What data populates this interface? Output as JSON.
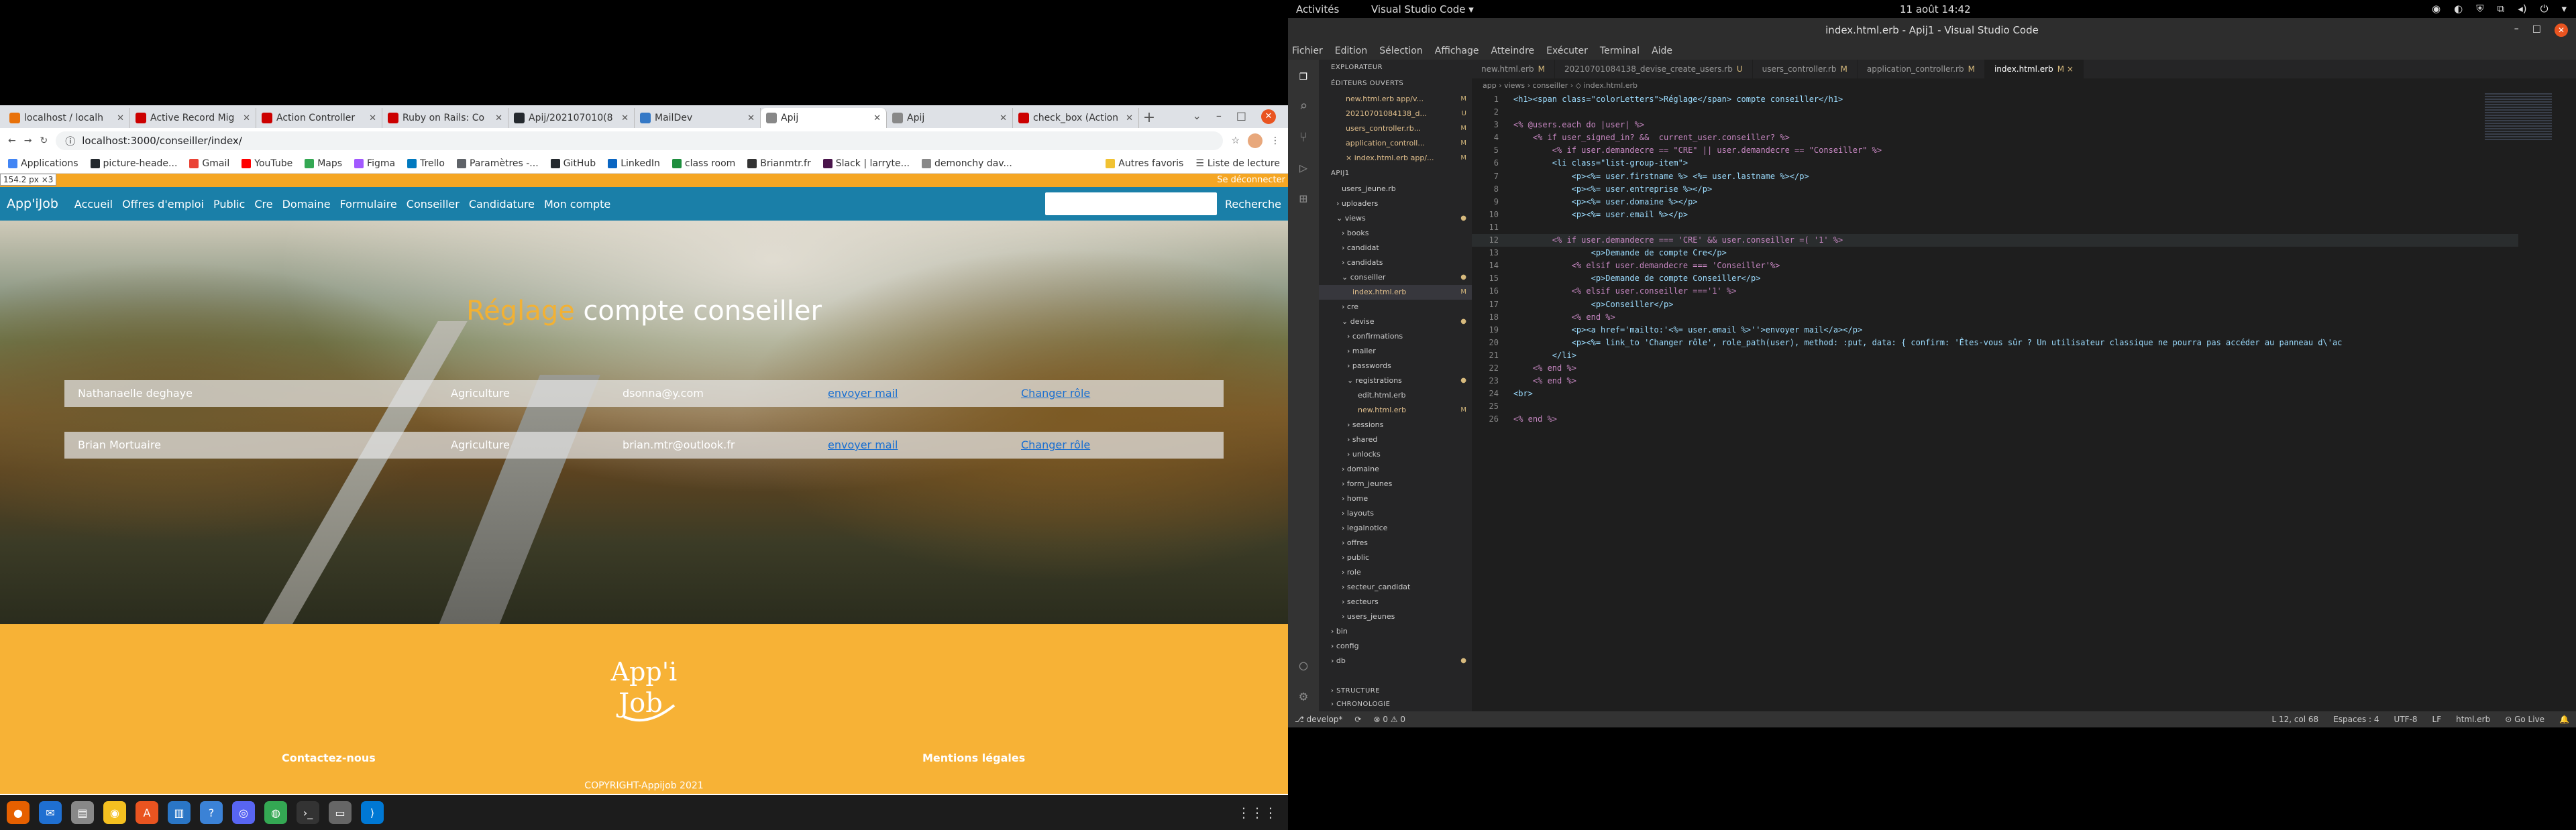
{
  "topbar": {
    "activities": "Activités",
    "app": "Visual Studio Code ▾",
    "clock": "11 août  14:42"
  },
  "browser": {
    "tabs": [
      {
        "title": "localhost / localh",
        "color": "#e8710a"
      },
      {
        "title": "Active Record Mig",
        "color": "#cc0000"
      },
      {
        "title": "Action Controller",
        "color": "#cc0000"
      },
      {
        "title": "Ruby on Rails: Co",
        "color": "#cc0000"
      },
      {
        "title": "Apij/202107010(8",
        "color": "#24292e"
      },
      {
        "title": "MailDev",
        "color": "#3478c6"
      },
      {
        "title": "Apij",
        "color": "#888888"
      },
      {
        "title": "Apij",
        "color": "#888888"
      },
      {
        "title": "check_box (Action",
        "color": "#cc0000"
      }
    ],
    "new_tab": "+",
    "url": "localhost:3000/conseiller/index/",
    "bookmarks": [
      {
        "label": "Applications",
        "color": "#4285f4"
      },
      {
        "label": "picture-heade...",
        "color": "#24292e"
      },
      {
        "label": "Gmail",
        "color": "#ea4335"
      },
      {
        "label": "YouTube",
        "color": "#ff0000"
      },
      {
        "label": "Maps",
        "color": "#34a853"
      },
      {
        "label": "Figma",
        "color": "#a259ff"
      },
      {
        "label": "Trello",
        "color": "#0079bf"
      },
      {
        "label": "Paramètres -...",
        "color": "#5f6368"
      },
      {
        "label": "GitHub",
        "color": "#24292e"
      },
      {
        "label": "LinkedIn",
        "color": "#0a66c2"
      },
      {
        "label": "class room",
        "color": "#1e8e3e"
      },
      {
        "label": "Brianmtr.fr",
        "color": "#333333"
      },
      {
        "label": "Slack | larryte...",
        "color": "#4a154b"
      },
      {
        "label": "demonchy dav...",
        "color": "#888888"
      }
    ],
    "other_bookmarks": "Autres favoris",
    "reading_list": "Liste de lecture",
    "viewport_size": "154.2 px ×3",
    "logout": "Se déconnecter"
  },
  "app": {
    "brand": "App'iJob",
    "nav": [
      "Accueil",
      "Offres d'emploi",
      "Public",
      "Cre",
      "Domaine",
      "Formulaire",
      "Conseiller",
      "Candidature",
      "Mon compte"
    ],
    "search_button": "Recherche",
    "title_highlight": "Réglage",
    "title_rest": " compte conseiller",
    "users": [
      {
        "name": "Nathanaelle deghaye",
        "domain": "Agriculture",
        "email": "dsonna@y.com",
        "mail_link": "envoyer mail",
        "role_link": "Changer rôle"
      },
      {
        "name": "Brian Mortuaire",
        "domain": "Agriculture",
        "email": "brian.mtr@outlook.fr",
        "mail_link": "envoyer mail",
        "role_link": "Changer rôle"
      }
    ],
    "footer": {
      "logo_top": "App'i",
      "logo_bottom": "Job",
      "contact": "Contactez-nous",
      "legal": "Mentions légales",
      "copyright": "COPYRIGHT-Appijob 2021"
    }
  },
  "dock": {
    "apps": [
      {
        "name": "firefox-icon",
        "color": "#e66000",
        "glyph": "●"
      },
      {
        "name": "thunderbird-icon",
        "color": "#1f6fd1",
        "glyph": "✉"
      },
      {
        "name": "files-icon",
        "color": "#888888",
        "glyph": "▤"
      },
      {
        "name": "rhythmbox-icon",
        "color": "#f4c020",
        "glyph": "◉"
      },
      {
        "name": "software-icon",
        "color": "#e95420",
        "glyph": "A"
      },
      {
        "name": "writer-icon",
        "color": "#2a76c6",
        "glyph": "▥"
      },
      {
        "name": "help-icon",
        "color": "#3b82d6",
        "glyph": "?"
      },
      {
        "name": "discord-icon",
        "color": "#5865f2",
        "glyph": "◎"
      },
      {
        "name": "chrome-icon",
        "color": "#34a853",
        "glyph": "◍"
      },
      {
        "name": "terminal-icon",
        "color": "#333333",
        "glyph": "›_"
      },
      {
        "name": "files2-icon",
        "color": "#666666",
        "glyph": "▭"
      },
      {
        "name": "vscode-icon",
        "color": "#0078d4",
        "glyph": "⟩"
      }
    ],
    "grid": "⋮⋮⋮"
  },
  "vscode": {
    "title": "index.html.erb - Apij1 - Visual Studio Code",
    "menu": [
      "Fichier",
      "Edition",
      "Sélection",
      "Affichage",
      "Atteindre",
      "Exécuter",
      "Terminal",
      "Aide"
    ],
    "open_editors_label": "ÉDITEURS OUVERTS",
    "open_editors": [
      {
        "name": "new.html.erb  app/v...",
        "mark": "M"
      },
      {
        "name": "20210701084138_d...",
        "mark": "U"
      },
      {
        "name": "users_controller.rb...",
        "mark": "M"
      },
      {
        "name": "application_controll...",
        "mark": "M"
      },
      {
        "name": "× index.html.erb  app/...",
        "mark": "M"
      }
    ],
    "project_label": "APIJ1",
    "explorer_header": "EXPLORATEUR",
    "tree": [
      {
        "label": "users_jeune.rb",
        "indent": 24,
        "mark": ""
      },
      {
        "label": "› uploaders",
        "indent": 16,
        "mark": ""
      },
      {
        "label": "⌄ views",
        "indent": 16,
        "mark": "●"
      },
      {
        "label": "› books",
        "indent": 24,
        "mark": ""
      },
      {
        "label": "› candidat",
        "indent": 24,
        "mark": ""
      },
      {
        "label": "› candidats",
        "indent": 24,
        "mark": ""
      },
      {
        "label": "⌄ conseiller",
        "indent": 24,
        "mark": "●"
      },
      {
        "label": "index.html.erb",
        "indent": 40,
        "mark": "M"
      },
      {
        "label": "› cre",
        "indent": 24,
        "mark": ""
      },
      {
        "label": "⌄ devise",
        "indent": 24,
        "mark": "●"
      },
      {
        "label": "› confirmations",
        "indent": 32,
        "mark": ""
      },
      {
        "label": "› mailer",
        "indent": 32,
        "mark": ""
      },
      {
        "label": "› passwords",
        "indent": 32,
        "mark": ""
      },
      {
        "label": "⌄ registrations",
        "indent": 32,
        "mark": "●"
      },
      {
        "label": "edit.html.erb",
        "indent": 48,
        "mark": ""
      },
      {
        "label": "new.html.erb",
        "indent": 48,
        "mark": "M"
      },
      {
        "label": "› sessions",
        "indent": 32,
        "mark": ""
      },
      {
        "label": "› shared",
        "indent": 32,
        "mark": ""
      },
      {
        "label": "› unlocks",
        "indent": 32,
        "mark": ""
      },
      {
        "label": "› domaine",
        "indent": 24,
        "mark": ""
      },
      {
        "label": "› form_jeunes",
        "indent": 24,
        "mark": ""
      },
      {
        "label": "› home",
        "indent": 24,
        "mark": ""
      },
      {
        "label": "› layouts",
        "indent": 24,
        "mark": ""
      },
      {
        "label": "› legalnotice",
        "indent": 24,
        "mark": ""
      },
      {
        "label": "› offres",
        "indent": 24,
        "mark": ""
      },
      {
        "label": "› public",
        "indent": 24,
        "mark": ""
      },
      {
        "label": "› role",
        "indent": 24,
        "mark": ""
      },
      {
        "label": "› secteur_candidat",
        "indent": 24,
        "mark": ""
      },
      {
        "label": "› secteurs",
        "indent": 24,
        "mark": ""
      },
      {
        "label": "› users_jeunes",
        "indent": 24,
        "mark": ""
      },
      {
        "label": "› bin",
        "indent": 8,
        "mark": ""
      },
      {
        "label": "› config",
        "indent": 8,
        "mark": ""
      },
      {
        "label": "› db",
        "indent": 8,
        "mark": "●"
      }
    ],
    "outline": "› STRUCTURE",
    "timeline": "› CHRONOLOGIE",
    "tabs": [
      {
        "label": "new.html.erb",
        "mark": "M",
        "active": false
      },
      {
        "label": "20210701084138_devise_create_users.rb",
        "mark": "U",
        "active": false
      },
      {
        "label": "users_controller.rb",
        "mark": "M",
        "active": false
      },
      {
        "label": "application_controller.rb",
        "mark": "M",
        "active": false
      },
      {
        "label": "index.html.erb",
        "mark": "M ×",
        "active": true
      }
    ],
    "breadcrumb": "app › views › conseiller › ◇ index.html.erb",
    "code": [
      "<h1><span class=\"colorLetters\">Réglage</span> compte conseiller</h1>",
      "",
      "<% @users.each do |user| %>",
      "    <% if user_signed_in? &&  current_user.conseiller? %>",
      "        <% if user.demandecre == \"CRE\" || user.demandecre == \"Conseiller\" %>",
      "        <li class=\"list-group-item\">",
      "            <p><%= user.firstname %> <%= user.lastname %></p>",
      "            <p><%= user.entreprise %></p>",
      "            <p><%= user.domaine %></p>",
      "            <p><%= user.email %></p>",
      "",
      "        <% if user.demandecre === 'CRE' && user.conseiller =( '1' %>",
      "                <p>Demande de compte Cre</p>",
      "            <% elsif user.demandecre === 'Conseiller'%>",
      "                <p>Demande de compte Conseiller</p>",
      "            <% elsif user.conseiller ==='1' %>",
      "                <p>Conseiller</p>",
      "            <% end %>",
      "            <p><a href='mailto:'<%= user.email %>''>envoyer mail</a></p>",
      "            <p><%= link_to 'Changer rôle', role_path(user), method: :put, data: { confirm: 'Êtes-vous sûr ? Un utilisateur classique ne pourra pas accéder au panneau d\\'ac",
      "        </li>",
      "    <% end %>",
      "    <% end %>",
      "<br>",
      "",
      "<% end %>"
    ],
    "status": {
      "branch": "⎇ develop*",
      "sync": "⟳",
      "problems": "⊗ 0 ⚠ 0",
      "position": "L 12, col 68",
      "spaces": "Espaces : 4",
      "encoding": "UTF-8",
      "eol": "LF",
      "language": "html.erb",
      "golive": "⊙ Go Live"
    }
  }
}
